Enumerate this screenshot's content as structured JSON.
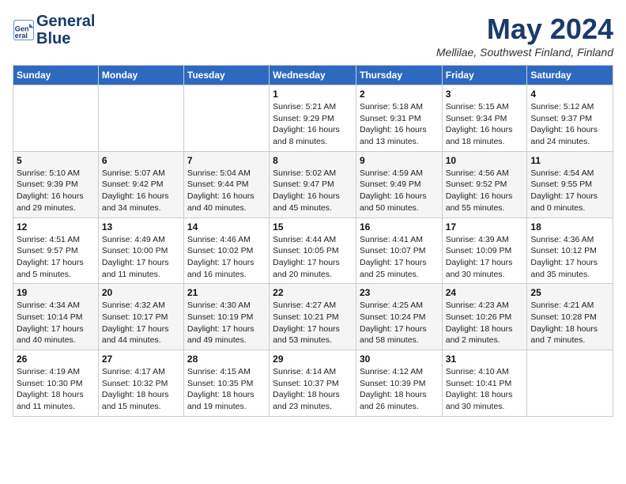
{
  "header": {
    "logo_line1": "General",
    "logo_line2": "Blue",
    "month": "May 2024",
    "location": "Mellilae, Southwest Finland, Finland"
  },
  "weekdays": [
    "Sunday",
    "Monday",
    "Tuesday",
    "Wednesday",
    "Thursday",
    "Friday",
    "Saturday"
  ],
  "weeks": [
    [
      {
        "day": "",
        "info": ""
      },
      {
        "day": "",
        "info": ""
      },
      {
        "day": "",
        "info": ""
      },
      {
        "day": "1",
        "info": "Sunrise: 5:21 AM\nSunset: 9:29 PM\nDaylight: 16 hours\nand 8 minutes."
      },
      {
        "day": "2",
        "info": "Sunrise: 5:18 AM\nSunset: 9:31 PM\nDaylight: 16 hours\nand 13 minutes."
      },
      {
        "day": "3",
        "info": "Sunrise: 5:15 AM\nSunset: 9:34 PM\nDaylight: 16 hours\nand 18 minutes."
      },
      {
        "day": "4",
        "info": "Sunrise: 5:12 AM\nSunset: 9:37 PM\nDaylight: 16 hours\nand 24 minutes."
      }
    ],
    [
      {
        "day": "5",
        "info": "Sunrise: 5:10 AM\nSunset: 9:39 PM\nDaylight: 16 hours\nand 29 minutes."
      },
      {
        "day": "6",
        "info": "Sunrise: 5:07 AM\nSunset: 9:42 PM\nDaylight: 16 hours\nand 34 minutes."
      },
      {
        "day": "7",
        "info": "Sunrise: 5:04 AM\nSunset: 9:44 PM\nDaylight: 16 hours\nand 40 minutes."
      },
      {
        "day": "8",
        "info": "Sunrise: 5:02 AM\nSunset: 9:47 PM\nDaylight: 16 hours\nand 45 minutes."
      },
      {
        "day": "9",
        "info": "Sunrise: 4:59 AM\nSunset: 9:49 PM\nDaylight: 16 hours\nand 50 minutes."
      },
      {
        "day": "10",
        "info": "Sunrise: 4:56 AM\nSunset: 9:52 PM\nDaylight: 16 hours\nand 55 minutes."
      },
      {
        "day": "11",
        "info": "Sunrise: 4:54 AM\nSunset: 9:55 PM\nDaylight: 17 hours\nand 0 minutes."
      }
    ],
    [
      {
        "day": "12",
        "info": "Sunrise: 4:51 AM\nSunset: 9:57 PM\nDaylight: 17 hours\nand 5 minutes."
      },
      {
        "day": "13",
        "info": "Sunrise: 4:49 AM\nSunset: 10:00 PM\nDaylight: 17 hours\nand 11 minutes."
      },
      {
        "day": "14",
        "info": "Sunrise: 4:46 AM\nSunset: 10:02 PM\nDaylight: 17 hours\nand 16 minutes."
      },
      {
        "day": "15",
        "info": "Sunrise: 4:44 AM\nSunset: 10:05 PM\nDaylight: 17 hours\nand 20 minutes."
      },
      {
        "day": "16",
        "info": "Sunrise: 4:41 AM\nSunset: 10:07 PM\nDaylight: 17 hours\nand 25 minutes."
      },
      {
        "day": "17",
        "info": "Sunrise: 4:39 AM\nSunset: 10:09 PM\nDaylight: 17 hours\nand 30 minutes."
      },
      {
        "day": "18",
        "info": "Sunrise: 4:36 AM\nSunset: 10:12 PM\nDaylight: 17 hours\nand 35 minutes."
      }
    ],
    [
      {
        "day": "19",
        "info": "Sunrise: 4:34 AM\nSunset: 10:14 PM\nDaylight: 17 hours\nand 40 minutes."
      },
      {
        "day": "20",
        "info": "Sunrise: 4:32 AM\nSunset: 10:17 PM\nDaylight: 17 hours\nand 44 minutes."
      },
      {
        "day": "21",
        "info": "Sunrise: 4:30 AM\nSunset: 10:19 PM\nDaylight: 17 hours\nand 49 minutes."
      },
      {
        "day": "22",
        "info": "Sunrise: 4:27 AM\nSunset: 10:21 PM\nDaylight: 17 hours\nand 53 minutes."
      },
      {
        "day": "23",
        "info": "Sunrise: 4:25 AM\nSunset: 10:24 PM\nDaylight: 17 hours\nand 58 minutes."
      },
      {
        "day": "24",
        "info": "Sunrise: 4:23 AM\nSunset: 10:26 PM\nDaylight: 18 hours\nand 2 minutes."
      },
      {
        "day": "25",
        "info": "Sunrise: 4:21 AM\nSunset: 10:28 PM\nDaylight: 18 hours\nand 7 minutes."
      }
    ],
    [
      {
        "day": "26",
        "info": "Sunrise: 4:19 AM\nSunset: 10:30 PM\nDaylight: 18 hours\nand 11 minutes."
      },
      {
        "day": "27",
        "info": "Sunrise: 4:17 AM\nSunset: 10:32 PM\nDaylight: 18 hours\nand 15 minutes."
      },
      {
        "day": "28",
        "info": "Sunrise: 4:15 AM\nSunset: 10:35 PM\nDaylight: 18 hours\nand 19 minutes."
      },
      {
        "day": "29",
        "info": "Sunrise: 4:14 AM\nSunset: 10:37 PM\nDaylight: 18 hours\nand 23 minutes."
      },
      {
        "day": "30",
        "info": "Sunrise: 4:12 AM\nSunset: 10:39 PM\nDaylight: 18 hours\nand 26 minutes."
      },
      {
        "day": "31",
        "info": "Sunrise: 4:10 AM\nSunset: 10:41 PM\nDaylight: 18 hours\nand 30 minutes."
      },
      {
        "day": "",
        "info": ""
      }
    ]
  ]
}
